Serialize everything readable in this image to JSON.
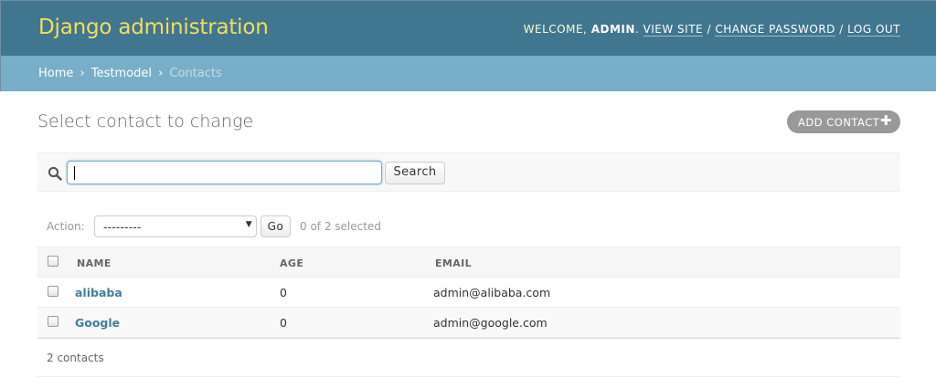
{
  "header": {
    "site_name": "Django administration",
    "welcome": "Welcome,",
    "user": "admin",
    "view_site": "View site",
    "change_password": "Change password",
    "log_out": "Log out",
    "separator": "/"
  },
  "breadcrumbs": {
    "home": "Home",
    "app": "Testmodel",
    "current": "Contacts",
    "separator": "›"
  },
  "page": {
    "title": "Select contact to change",
    "add_button": "Add contact",
    "add_icon": "plus-icon"
  },
  "search": {
    "icon": "search-icon",
    "value": "",
    "button": "Search"
  },
  "actions": {
    "label": "Action:",
    "selected_option": "---------",
    "go_button": "Go",
    "selected_count": "0 of 2 selected"
  },
  "table": {
    "headers": [
      "Name",
      "Age",
      "Email"
    ],
    "rows": [
      {
        "name": "alibaba",
        "age": "0",
        "email": "admin@alibaba.com"
      },
      {
        "name": "Google",
        "age": "0",
        "email": "admin@google.com"
      }
    ]
  },
  "paginator": {
    "text": "2 contacts"
  },
  "colors": {
    "header_bg": "#417690",
    "breadcrumb_bg": "#79aec8",
    "branding": "#f5dd5d",
    "link": "#447e9b"
  }
}
